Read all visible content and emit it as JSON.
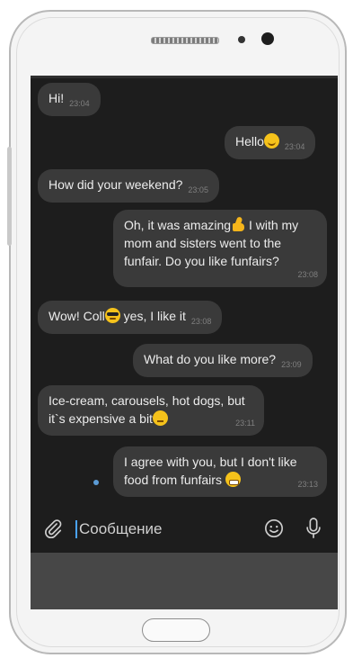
{
  "chat": {
    "messages": [
      {
        "from": "other",
        "text": "Hi!",
        "time": "23:04"
      },
      {
        "from": "me",
        "text": "Hello",
        "emoji": "smile",
        "time": "23:04"
      },
      {
        "from": "other",
        "text": "How did your weekend?",
        "time": "23:05"
      },
      {
        "from": "me",
        "line1a": "Oh, it was amazing",
        "line1b": " I with my",
        "line2": "mom and sisters went to the",
        "line3": "funfair. Do you like funfairs?",
        "time": "23:08"
      },
      {
        "from": "other",
        "text_a": "Wow! Coll",
        "text_b": " yes, I like it",
        "time": "23:08"
      },
      {
        "from": "me",
        "text": "What do you like  more?",
        "time": "23:09"
      },
      {
        "from": "other",
        "line1": "Ice-cream, carousels, hot dogs, but",
        "line2": "it`s expensive a bit",
        "time": "23:11"
      },
      {
        "from": "me",
        "line1": "I agree  with you,  but I don't like",
        "line2": "food  from funfairs ",
        "time": "23:13"
      }
    ]
  },
  "composer": {
    "placeholder": "Сообщение",
    "attach_icon": "paperclip-icon",
    "emoji_icon": "smiley-icon",
    "mic_icon": "microphone-icon"
  },
  "colors": {
    "screen_bg": "#1d1d1d",
    "bubble_bg": "#3a3a3a",
    "caret": "#4aa3ff"
  }
}
